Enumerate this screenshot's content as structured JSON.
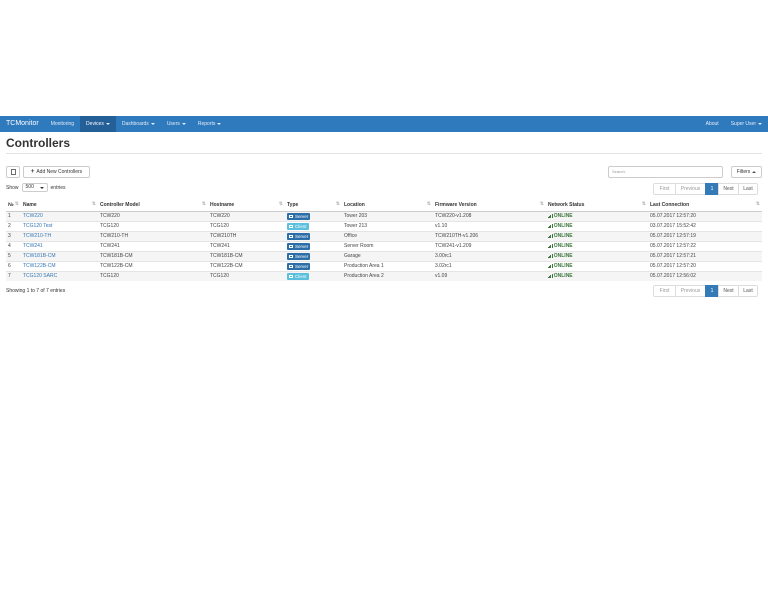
{
  "nav": {
    "brand": "TCMonitor",
    "items": [
      {
        "label": "Monitoring",
        "dropdown": false,
        "active": false
      },
      {
        "label": "Devices",
        "dropdown": true,
        "active": true
      },
      {
        "label": "Dashboards",
        "dropdown": true,
        "active": false
      },
      {
        "label": "Users",
        "dropdown": true,
        "active": false
      },
      {
        "label": "Reports",
        "dropdown": true,
        "active": false
      }
    ],
    "right": [
      {
        "label": "About",
        "dropdown": false
      },
      {
        "label": "Super User",
        "dropdown": true
      }
    ]
  },
  "page": {
    "title": "Controllers"
  },
  "toolbar": {
    "add_label": "Add New Controllers",
    "search_placeholder": "Search:",
    "filters_label": "Filters"
  },
  "length": {
    "show_label": "Show",
    "value": "500",
    "entries_label": "entries"
  },
  "pager": {
    "first": "First",
    "previous": "Previous",
    "current": "1",
    "next": "Next",
    "last": "Last"
  },
  "table": {
    "headers": [
      "№",
      "Name",
      "Controller Model",
      "Hostname",
      "Type",
      "Location",
      "Firmware Version",
      "Network Status",
      "Last Connection"
    ],
    "rows": [
      {
        "no": "1",
        "name": "TCW220",
        "model": "TCW220",
        "hostname": "TCW220",
        "type": "Server",
        "location": "Tower 203",
        "firmware": "TCW220-v1.208",
        "status": "ONLINE",
        "last": "05.07.2017 12:57:20"
      },
      {
        "no": "2",
        "name": "TCG120 Test",
        "model": "TCG120",
        "hostname": "TCG120",
        "type": "Client",
        "location": "Tower 213",
        "firmware": "v1.10",
        "status": "ONLINE",
        "last": "03.07.2017 15:52:42"
      },
      {
        "no": "3",
        "name": "TCW210-TH",
        "model": "TCW210-TH",
        "hostname": "TCW210TH",
        "type": "Server",
        "location": "Office",
        "firmware": "TCW210TH-v1.206",
        "status": "ONLINE",
        "last": "05.07.2017 12:57:19"
      },
      {
        "no": "4",
        "name": "TCW241",
        "model": "TCW241",
        "hostname": "TCW241",
        "type": "Server",
        "location": "Server Room",
        "firmware": "TCW241-v1.209",
        "status": "ONLINE",
        "last": "05.07.2017 12:57:22"
      },
      {
        "no": "5",
        "name": "TCW181B-CM",
        "model": "TCW181B-CM",
        "hostname": "TCW181B-CM",
        "type": "Server",
        "location": "Garage",
        "firmware": "3.00rc1",
        "status": "ONLINE",
        "last": "05.07.2017 12:57:21"
      },
      {
        "no": "6",
        "name": "TCW122B-CM",
        "model": "TCW122B-CM",
        "hostname": "TCW122B-CM",
        "type": "Server",
        "location": "Production Area 1",
        "firmware": "3.02rc1",
        "status": "ONLINE",
        "last": "05.07.2017 12:57:20"
      },
      {
        "no": "7",
        "name": "TCG120 SARC",
        "model": "TCG120",
        "hostname": "TCG120",
        "type": "Client",
        "location": "Production Area 2",
        "firmware": "v1.09",
        "status": "ONLINE",
        "last": "05.07.2017 12:56:02"
      }
    ]
  },
  "info": "Showing 1 to 7 of 7 entries"
}
